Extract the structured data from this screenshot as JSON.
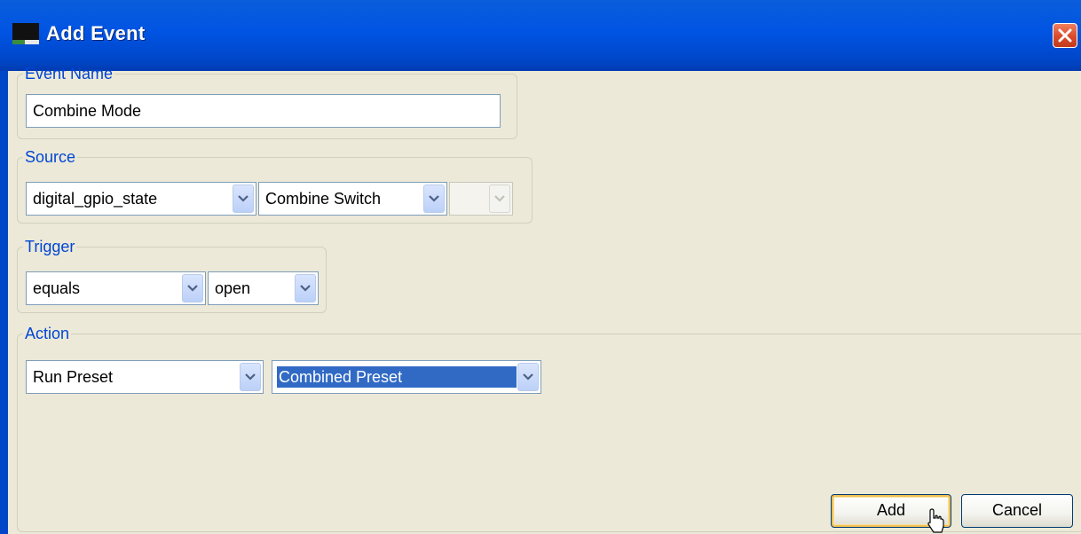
{
  "window": {
    "title": "Add Event",
    "icon": "application-icon",
    "close_icon": "close-icon",
    "colors": {
      "titlebar": "#0054E3",
      "face": "#ECE9D8",
      "legend": "#0046D5",
      "selection": "#316AC5",
      "close": "#D94A2A"
    }
  },
  "event_name": {
    "legend": "Event Name",
    "value": "Combine Mode"
  },
  "source": {
    "legend": "Source",
    "field": "digital_gpio_state",
    "item": "Combine Switch",
    "extra": ""
  },
  "trigger": {
    "legend": "Trigger",
    "operator": "equals",
    "value": "open"
  },
  "action": {
    "legend": "Action",
    "type": "Run Preset",
    "preset": "Combined Preset"
  },
  "buttons": {
    "add": "Add",
    "cancel": "Cancel"
  }
}
